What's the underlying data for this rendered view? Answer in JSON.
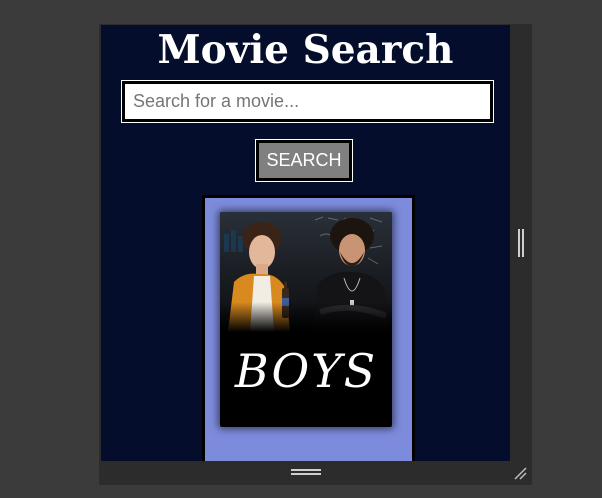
{
  "header": {
    "title": "Movie Search"
  },
  "search": {
    "placeholder": "Search for a movie...",
    "value": "",
    "button_label": "SEARCH"
  },
  "results": [
    {
      "title": "BOYS"
    }
  ]
}
